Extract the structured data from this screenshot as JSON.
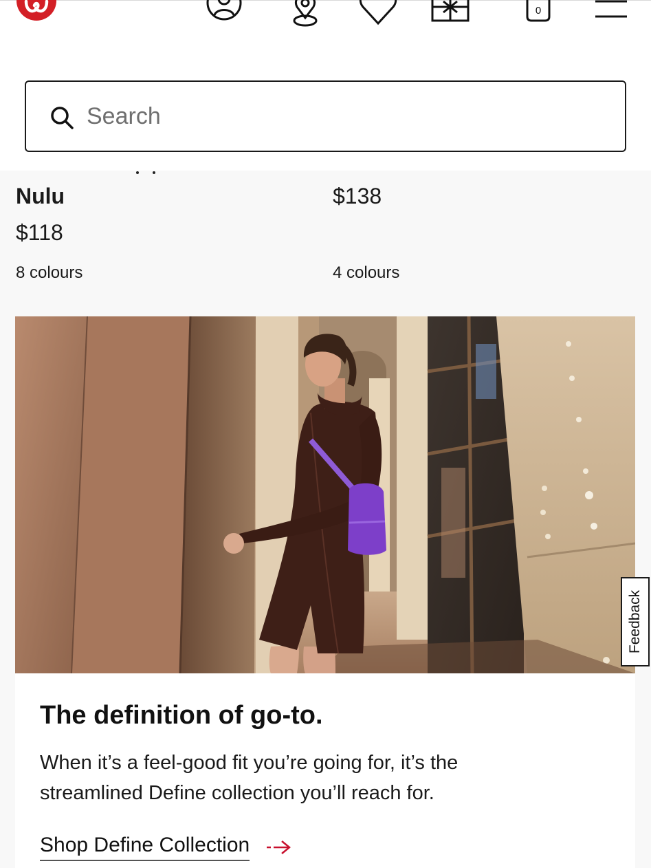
{
  "header": {
    "logo_name": "lululemon-logo",
    "icons": [
      "account-icon",
      "store-locator-icon",
      "wishlist-heart-icon",
      "gift-card-icon",
      "shopping-bag-icon",
      "menu-icon"
    ],
    "bag_count": "0",
    "brand_color": "#d31f26"
  },
  "search": {
    "placeholder": "Search"
  },
  "products": [
    {
      "name": "Nulu",
      "price": "$118",
      "colours": "8 colours"
    },
    {
      "name": "",
      "price": "$138",
      "colours": "4 colours"
    }
  ],
  "feedback": {
    "label": "Feedback"
  },
  "promo": {
    "title": "The definition of go-to.",
    "body": "When it’s a feel-good fit you’re going for, it’s the streamlined Define collection you’ll reach for.",
    "link_label": "Shop Define Collection",
    "accent_color": "#c8102e"
  }
}
